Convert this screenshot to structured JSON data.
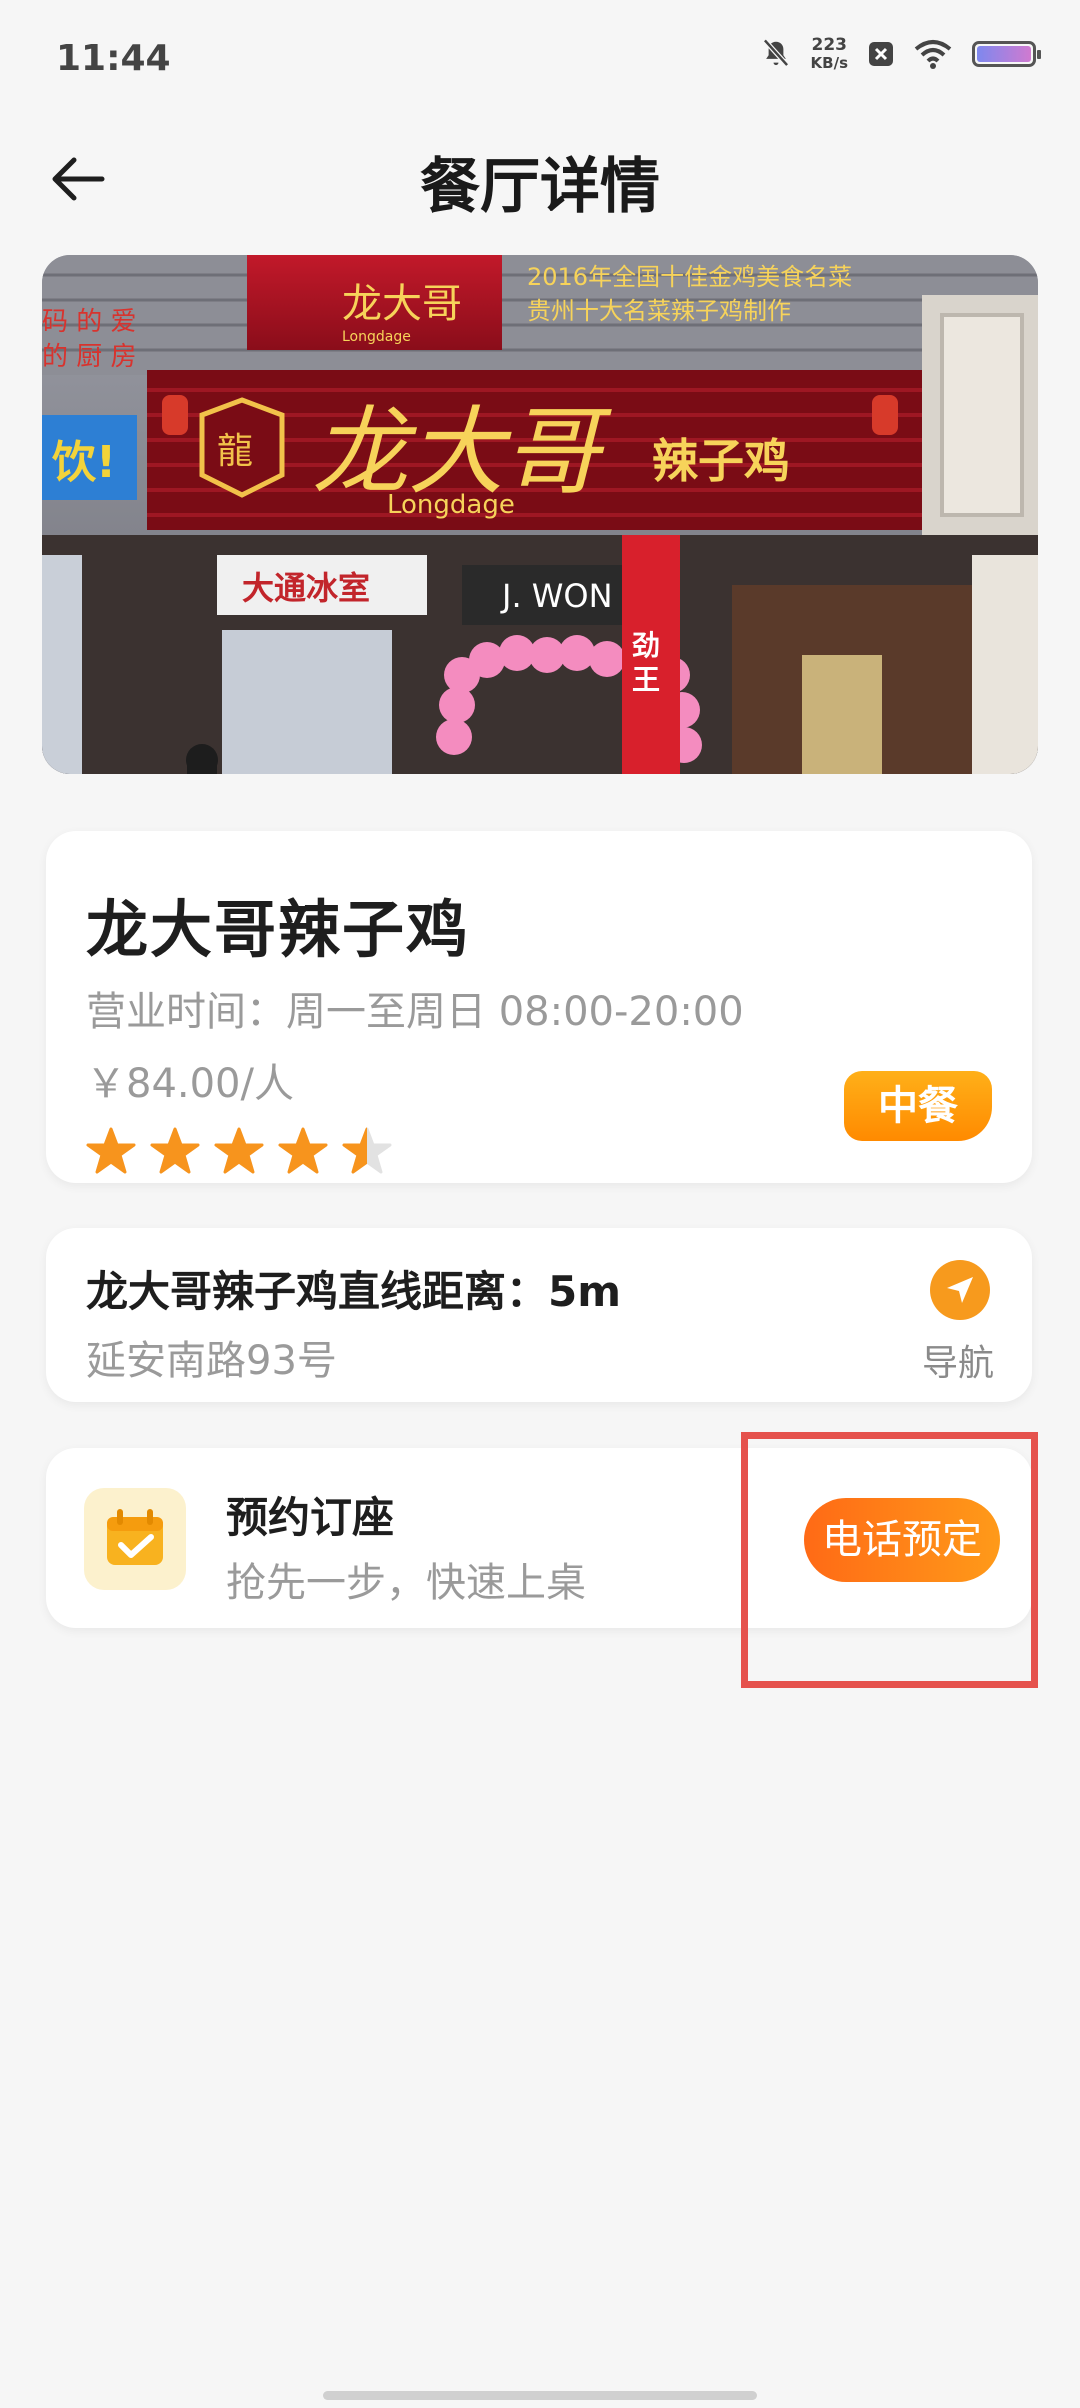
{
  "status_bar": {
    "time": "11:44",
    "net_speed_value": "223",
    "net_speed_unit": "KB/s",
    "icons": [
      "mute-bell-icon",
      "close-box-icon",
      "wifi-icon",
      "battery-icon"
    ]
  },
  "header": {
    "back_icon": "arrow-left-icon",
    "title": "餐厅详情"
  },
  "restaurant": {
    "name": "龙大哥辣子鸡",
    "hours": "营业时间：周一至周日 08:00-20:00",
    "price": "￥84.00/人",
    "rating": 4.5,
    "rating_max": 5,
    "cuisine": "中餐"
  },
  "distance": {
    "text": "龙大哥辣子鸡直线距离：5m",
    "address": "延安南路93号",
    "nav_label": "导航"
  },
  "reservation": {
    "title": "预约订座",
    "subtitle": "抢先一步，快速上桌",
    "button_label": "电话预定"
  },
  "photo_signage": {
    "main_brand": "龙大哥",
    "brand_en": "Longdage",
    "dish": "辣子鸡",
    "banner": "2016年全国十佳金鸡美食名菜",
    "banner2": "贵州十大名菜辣子鸡制作",
    "store_left": "大通冰室",
    "store_mid": "J. WON"
  },
  "colors": {
    "accent_orange": "#ff8a00",
    "highlight_red": "#e5524d",
    "star": "#f7941d",
    "star_empty": "#e2e2e2"
  }
}
